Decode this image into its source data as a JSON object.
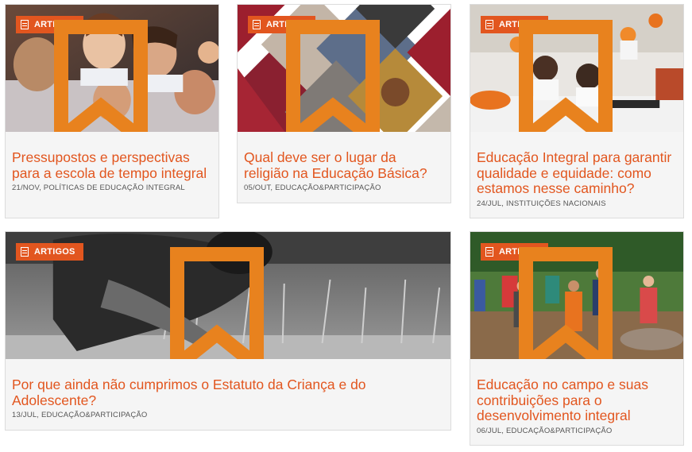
{
  "cards": [
    {
      "badge": "ARTIGOS",
      "title": "Pressupostos e perspectivas para a escola de tempo integral",
      "meta": "21/NOV, POLÍTICAS DE EDUCAÇÃO INTEGRAL",
      "image": "smiling-children-photo"
    },
    {
      "badge": "ARTIGOS",
      "title": "Qual deve ser o lugar da religião na Educação Básica?",
      "meta": "05/OUT, EDUCAÇÃO&PARTICIPAÇÃO",
      "image": "religion-mosaic-collage"
    },
    {
      "badge": "ARTIGOS",
      "title": "Educação Integral para garantir qualidade e equidade: como estamos nesse caminho?",
      "meta": "24/JUL, INSTITUIÇÕES NACIONAIS",
      "image": "students-writing-classroom-photo"
    },
    {
      "badge": "ARTIGOS",
      "title": "Por que ainda não cumprimos o Estatuto da Criança e do Adolescente?",
      "meta": "13/JUL, EDUCAÇÃO&PARTICIPAÇÃO",
      "image": "child-working-field-photo"
    },
    {
      "badge": "ARTIGOS",
      "title": "Educação no campo e suas contribuições para o desenvolvimento integral",
      "meta": "06/JUL, EDUCAÇÃO&PARTICIPAÇÃO",
      "image": "children-walking-countryside-photo"
    }
  ],
  "colors": {
    "accent": "#e2561f",
    "card_bg": "#f5f5f5",
    "border": "#dcdcdc"
  },
  "icons": {
    "badge": "document-icon",
    "action": "bookmark-icon"
  }
}
